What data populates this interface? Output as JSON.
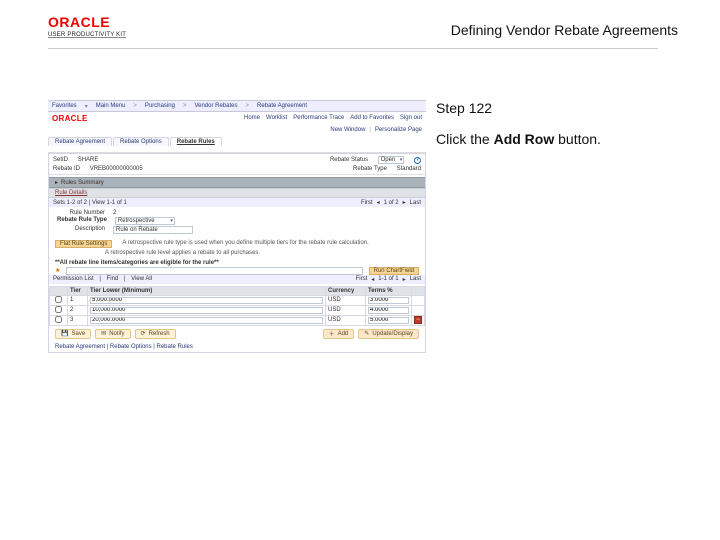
{
  "header": {
    "logo_text": "ORACLE",
    "logo_upk": "USER PRODUCTIVITY KIT",
    "title": "Defining Vendor Rebate Agreements"
  },
  "side": {
    "step": "Step 122",
    "instruction_pre": "Click the ",
    "instruction_bold": "Add Row",
    "instruction_post": " button."
  },
  "crumbs": [
    "Favorites",
    "Main Menu",
    "Purchasing",
    "Vendor Rebates",
    "Rebate Agreement"
  ],
  "top_links": [
    "Home",
    "Worklist",
    "Performance Trace",
    "Add to Favorites",
    "Sign out"
  ],
  "fav_line": {
    "new_window": "New Window",
    "personalize": "Personalize Page"
  },
  "tabs": {
    "a": "Rebate Agreement",
    "b": "Rebate Options",
    "c": "Rebate Rules",
    "active": 2
  },
  "panel": {
    "setid_lbl": "SetID",
    "setid_val": "SHARE",
    "status_lbl": "Rebate Status",
    "status_val": "Open",
    "rebateid_lbl": "Rebate ID",
    "rebateid_val": "VREB00000000005",
    "rtype_lbl": "Rebate Type",
    "rtype_val": "Standard"
  },
  "bars": {
    "rules_summary": "Rules Summary",
    "rule_details": "Rule Details"
  },
  "stripe": {
    "text0": "Sets 1-2 of 2  | View 1-1 of 1",
    "nav_first": "First",
    "nav_last": "Last",
    "nav_of": "1 of 2"
  },
  "rule": {
    "num_lbl": "Rule Number",
    "num_val": "2",
    "type_lbl": "Rebate Rule Type",
    "type_val": "Retrospective",
    "desc_lbl": "Description",
    "desc_val": "Rule on Rebate",
    "p1": "A retrospective rule type is used when you define multiple tiers for the rebate rule calculation.",
    "p2": "A retrospective rule level applies a rebate to all purchases."
  },
  "flat": {
    "btn": "Flat Rule Settings"
  },
  "eligible": {
    "note": "**All rebate line items/categories are eligible for the rule**",
    "perm_lbl": "Permission List",
    "find_lbl": "Find",
    "view_lbl": "View All",
    "first": "First",
    "last": "Last",
    "of": "1-1 of 1"
  },
  "grid": {
    "hdrs": [
      "",
      "Tier",
      "Tier Lower (Minimum)",
      "Currency",
      "Terms %",
      ""
    ],
    "rows": [
      {
        "tier": "1",
        "lower": "5,000.0000",
        "curr": "USD",
        "terms": "3.0000"
      },
      {
        "tier": "2",
        "lower": "10,000.0000",
        "curr": "USD",
        "terms": "4.0000"
      },
      {
        "tier": "3",
        "lower": "20,000.0000",
        "curr": "USD",
        "terms": "5.0000"
      }
    ]
  },
  "actions": {
    "save": "Save",
    "notify": "Notify",
    "refresh": "Refresh",
    "add": "Add",
    "update": "Update/Display"
  },
  "bottom": {
    "links": "Rebate Agreement | Rebate Options | Rebate Rules"
  },
  "chart_btn": "Run ChartField"
}
